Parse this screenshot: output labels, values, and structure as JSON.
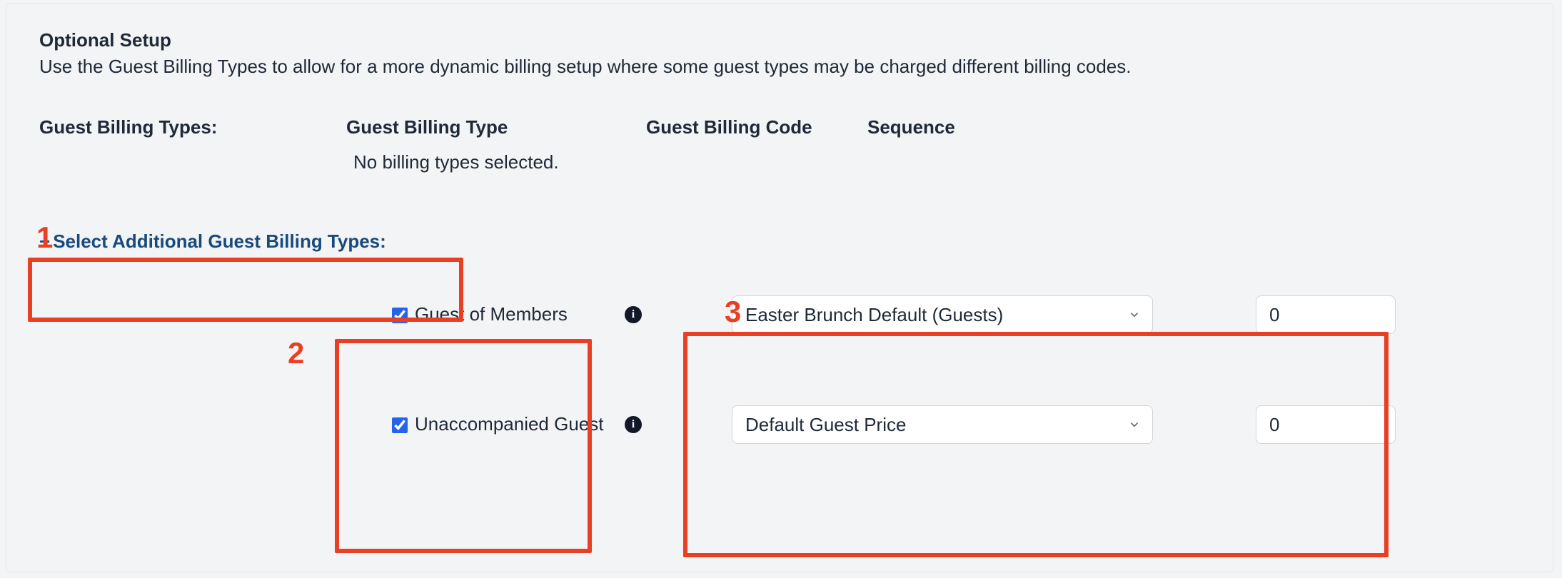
{
  "section": {
    "title": "Optional Setup",
    "description": "Use the Guest Billing Types to allow for a more dynamic billing setup where some guest types may be charged different billing codes."
  },
  "labels": {
    "guest_billing_types": "Guest Billing Types:",
    "guest_billing_type": "Guest Billing Type",
    "guest_billing_code": "Guest Billing Code",
    "sequence": "Sequence",
    "empty": "No billing types selected.",
    "add_link": "Select Additional Guest Billing Types:"
  },
  "annotations": {
    "n1": "1",
    "n2": "2",
    "n3": "3"
  },
  "rows": [
    {
      "checked": true,
      "label": "Guest of Members",
      "code": "Easter Brunch Default (Guests)",
      "sequence": "0"
    },
    {
      "checked": true,
      "label": "Unaccompanied Guest",
      "code": "Default Guest Price",
      "sequence": "0"
    }
  ]
}
